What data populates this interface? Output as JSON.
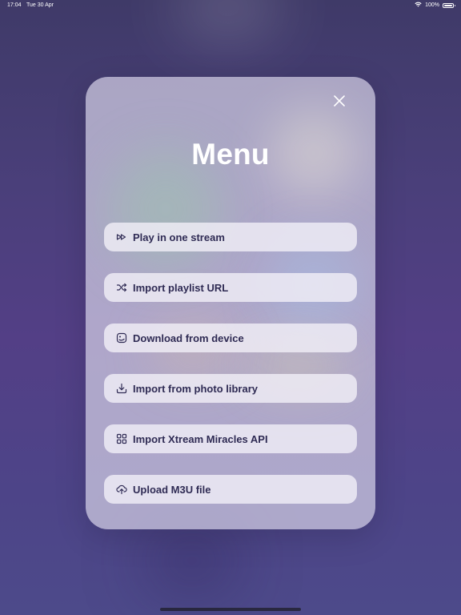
{
  "status_bar": {
    "time": "17:04",
    "date": "Tue 30 Apr",
    "battery": "100%",
    "wifi_icon": "wifi-icon",
    "battery_icon": "battery-icon"
  },
  "modal": {
    "title": "Menu",
    "close_icon": "close-icon",
    "items": [
      {
        "label": "Play in one stream",
        "icon": "fast-forward-icon"
      },
      {
        "label": "Import playlist URL",
        "icon": "shuffle-icon"
      },
      {
        "label": "Download from device",
        "icon": "image-icon"
      },
      {
        "label": "Import from photo library",
        "icon": "download-icon"
      },
      {
        "label": "Import Xtream Miracles API",
        "icon": "grid-icon"
      },
      {
        "label": "Upload M3U file",
        "icon": "cloud-upload-icon"
      }
    ]
  },
  "colors": {
    "background": "#4a3f7a",
    "modal_bg": "#d2cee4",
    "item_bg": "#f0eef6",
    "item_text": "#2f2b54",
    "title": "#ffffff"
  }
}
